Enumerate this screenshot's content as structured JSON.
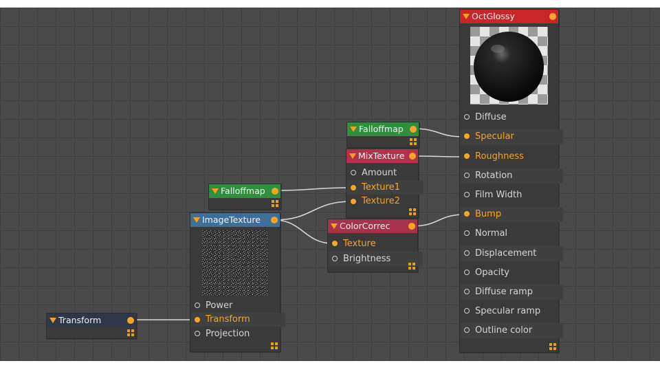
{
  "colors": {
    "canvas": "#4a4a4a",
    "grid": "#3f3f3f",
    "wire": "#d9d9d9",
    "port_active": "#f5a623",
    "header_glossy": "#c8272a",
    "header_falloff": "#2f8f3f",
    "header_mix": "#b3314b",
    "header_colorcorrect": "#a8324a",
    "header_image": "#3f6f99",
    "header_transform": "#2f3748"
  },
  "nodes": {
    "octglossy": {
      "title": "OctGlossy",
      "ports": [
        "Diffuse",
        "Specular",
        "Roughness",
        "Rotation",
        "Film Width",
        "Bump",
        "Normal",
        "Displacement",
        "Opacity",
        "Diffuse ramp",
        "Specular ramp",
        "Outline color"
      ]
    },
    "falloff1": {
      "title": "Falloffmap"
    },
    "mixtexture": {
      "title": "MixTexture",
      "ports": [
        "Amount",
        "Texture1",
        "Texture2"
      ]
    },
    "falloff2": {
      "title": "Falloffmap"
    },
    "imagetexture": {
      "title": "ImageTexture",
      "ports": [
        "Power",
        "Transform",
        "Projection"
      ]
    },
    "colorcorrect": {
      "title": "ColorCorrec",
      "ports": [
        "Texture",
        "Brightness"
      ]
    },
    "transform": {
      "title": "Transform"
    }
  }
}
